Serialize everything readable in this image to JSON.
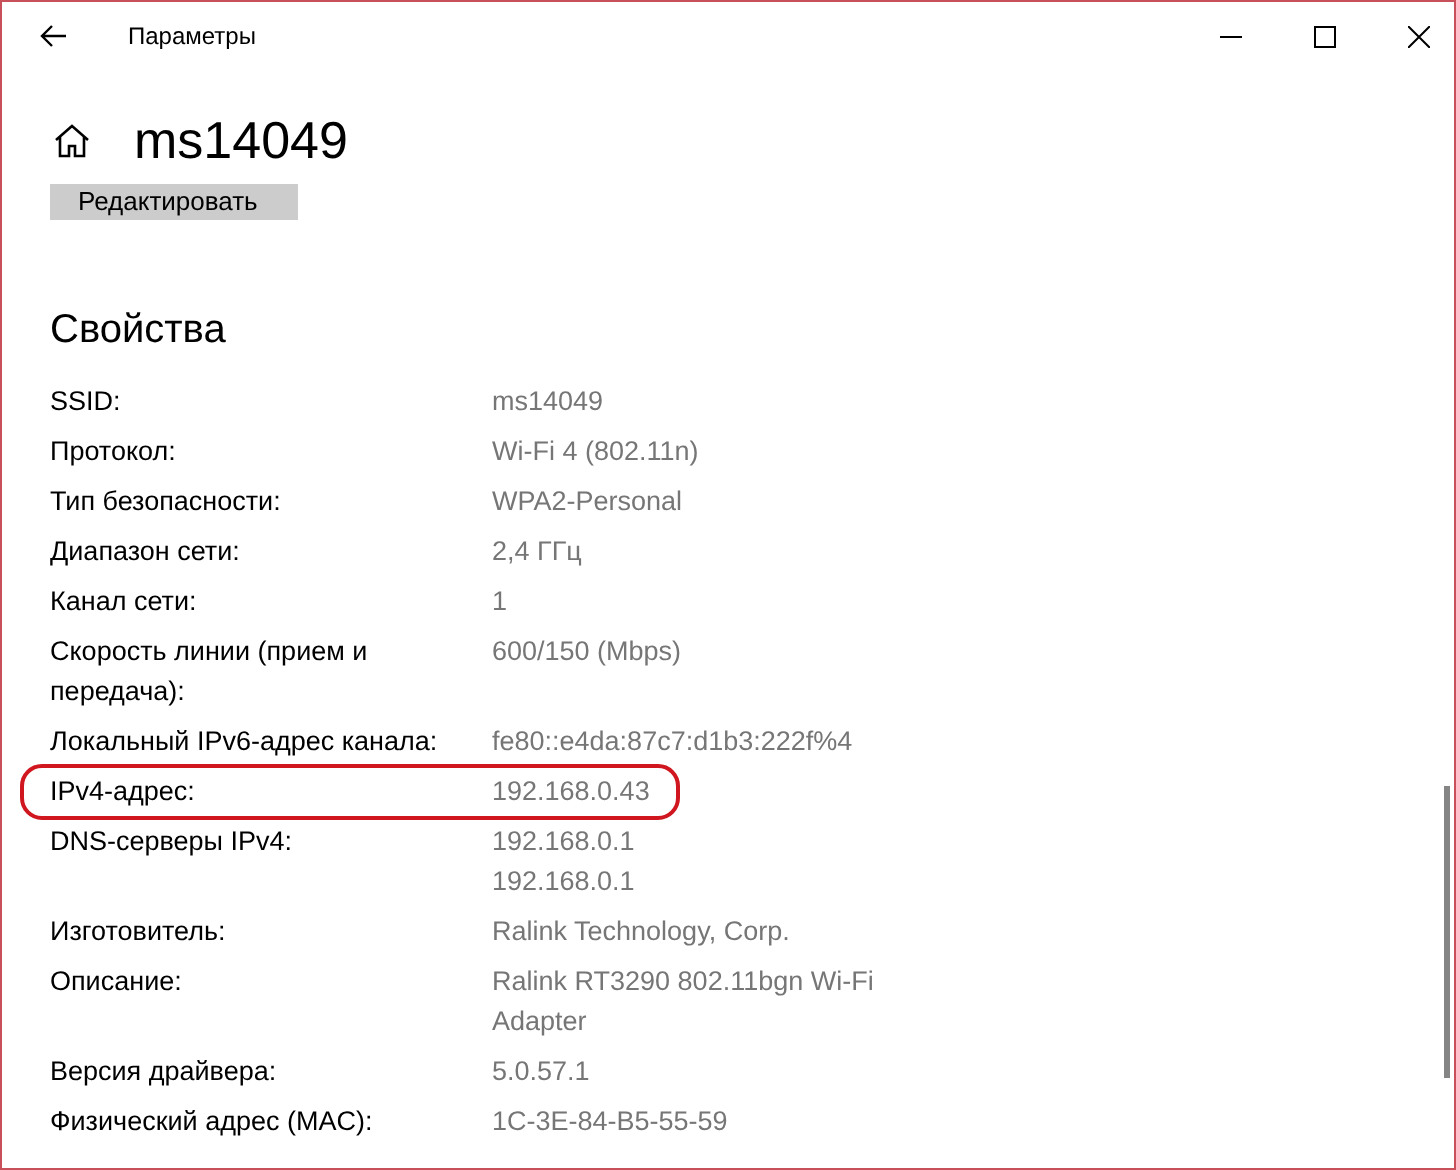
{
  "window": {
    "title": "Параметры"
  },
  "page": {
    "title": "ms14049",
    "edit_button": "Редактировать"
  },
  "properties": {
    "heading": "Свойства",
    "rows": [
      {
        "label": "SSID:",
        "values": [
          "ms14049"
        ],
        "highlighted": false
      },
      {
        "label": "Протокол:",
        "values": [
          "Wi-Fi 4 (802.11n)"
        ],
        "highlighted": false
      },
      {
        "label": "Тип безопасности:",
        "values": [
          "WPA2-Personal"
        ],
        "highlighted": false
      },
      {
        "label": "Диапазон сети:",
        "values": [
          "2,4 ГГц"
        ],
        "highlighted": false
      },
      {
        "label": "Канал сети:",
        "values": [
          "1"
        ],
        "highlighted": false
      },
      {
        "label": "Скорость линии (прием и передача):",
        "values": [
          "600/150 (Mbps)"
        ],
        "highlighted": false
      },
      {
        "label": "Локальный IPv6-адрес канала:",
        "values": [
          "fe80::e4da:87c7:d1b3:222f%4"
        ],
        "highlighted": false
      },
      {
        "label": "IPv4-адрес:",
        "values": [
          "192.168.0.43"
        ],
        "highlighted": true
      },
      {
        "label": "DNS-серверы IPv4:",
        "values": [
          "192.168.0.1",
          "192.168.0.1"
        ],
        "highlighted": false
      },
      {
        "label": "Изготовитель:",
        "values": [
          "Ralink Technology, Corp."
        ],
        "highlighted": false
      },
      {
        "label": "Описание:",
        "values": [
          "Ralink RT3290 802.11bgn Wi-Fi Adapter"
        ],
        "highlighted": false
      },
      {
        "label": "Версия драйвера:",
        "values": [
          "5.0.57.1"
        ],
        "highlighted": false
      },
      {
        "label": "Физический адрес (MAC):",
        "values": [
          "1C-3E-84-B5-55-59"
        ],
        "highlighted": false
      }
    ]
  }
}
